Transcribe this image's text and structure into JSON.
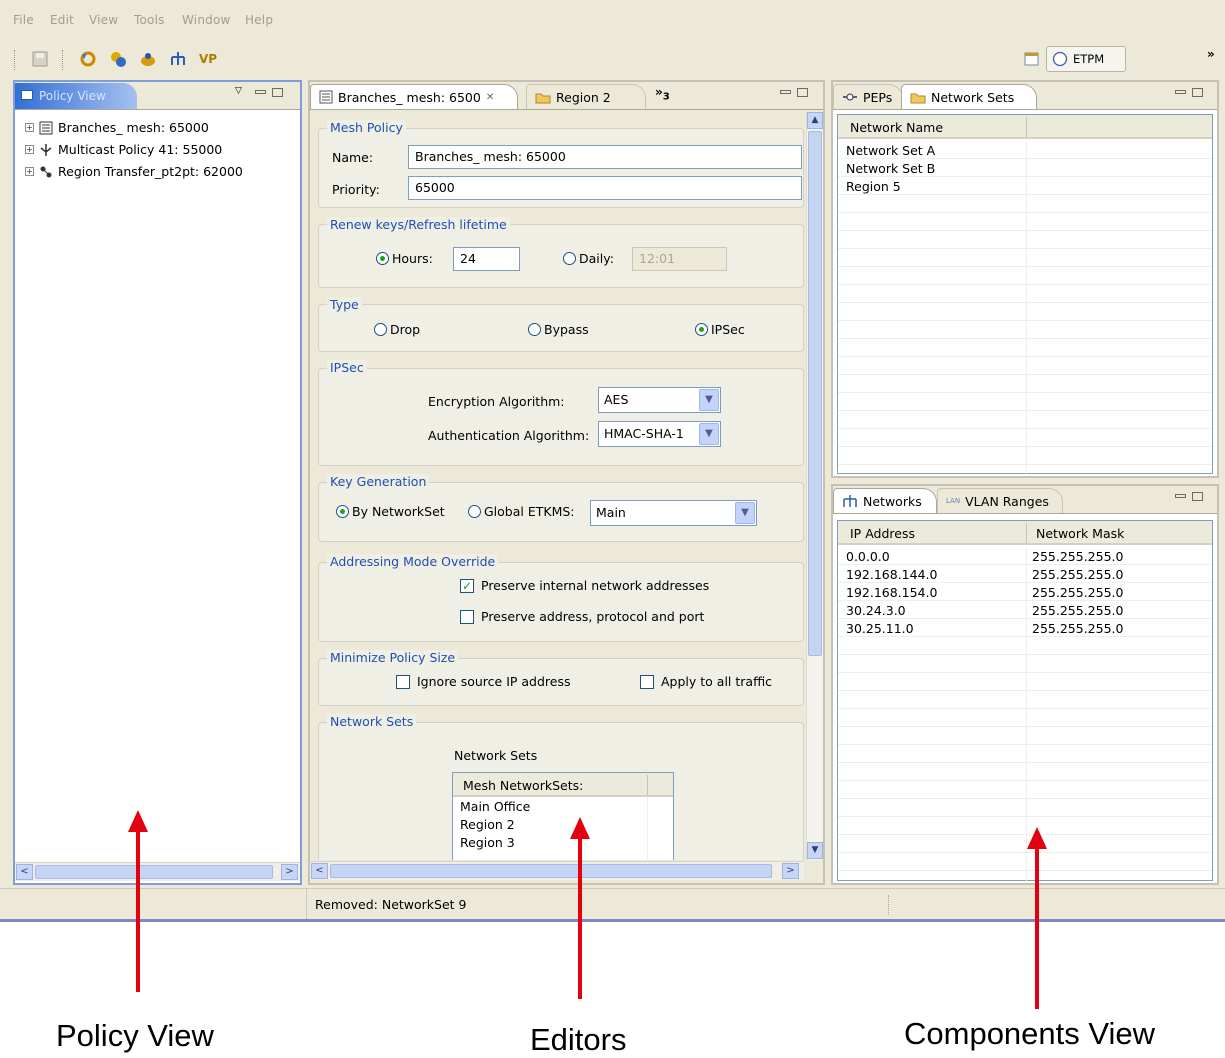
{
  "menu": [
    "File",
    "Edit",
    "View",
    "Tools",
    "Window",
    "Help"
  ],
  "toolbar": {
    "vp_label": "VP",
    "perspective_label": "ETPM",
    "chevron": "»"
  },
  "policy_view": {
    "tab_label": "Policy View",
    "items": [
      {
        "label": "Branches_ mesh: 65000",
        "icon": "mesh-policy-icon"
      },
      {
        "label": "Multicast Policy 41: 55000",
        "icon": "multicast-policy-icon"
      },
      {
        "label": "Region Transfer_pt2pt: 62000",
        "icon": "pt2pt-policy-icon"
      }
    ]
  },
  "editor": {
    "tabs": [
      {
        "label": "Branches_ mesh: 6500"
      },
      {
        "label": "Region 2"
      },
      {
        "label": "3"
      }
    ],
    "mesh_policy": {
      "title": "Mesh Policy",
      "name_label": "Name:",
      "name_value": "Branches_ mesh: 65000",
      "priority_label": "Priority:",
      "priority_value": "65000"
    },
    "renew": {
      "title": "Renew keys/Refresh lifetime",
      "hours_label": "Hours:",
      "hours_value": "24",
      "daily_label": "Daily:",
      "daily_value": "12:01"
    },
    "type": {
      "title": "Type",
      "options": [
        "Drop",
        "Bypass",
        "IPSec"
      ],
      "selected": "IPSec"
    },
    "ipsec": {
      "title": "IPSec",
      "enc_label": "Encryption Algorithm:",
      "enc_value": "AES",
      "auth_label": "Authentication Algorithm:",
      "auth_value": "HMAC-SHA-1"
    },
    "keygen": {
      "title": "Key Generation",
      "by_networkset_label": "By NetworkSet",
      "global_label": "Global ETKMS:",
      "global_value": "Main"
    },
    "addressing": {
      "title": "Addressing Mode Override",
      "preserve_internal": "Preserve internal network addresses",
      "preserve_internal_checked": true,
      "preserve_address": "Preserve address, protocol and port",
      "preserve_address_checked": false
    },
    "minimize": {
      "title": "Minimize Policy Size",
      "ignore_source": "Ignore source IP address",
      "apply_all": "Apply to all traffic"
    },
    "network_sets": {
      "title": "Network Sets",
      "subtitle": "Network Sets",
      "column": "Mesh NetworkSets:",
      "rows": [
        "Main Office",
        "Region 2",
        "Region 3"
      ]
    }
  },
  "components_top": {
    "tabs": [
      {
        "label": "PEPs"
      },
      {
        "label": "Network Sets"
      }
    ],
    "column": "Network Name",
    "rows": [
      "Network Set A",
      "Network Set B",
      "Region 5"
    ]
  },
  "components_bottom": {
    "tabs": [
      {
        "label": "Networks"
      },
      {
        "label": "VLAN Ranges"
      }
    ],
    "columns": [
      "IP Address",
      "Network Mask"
    ],
    "rows": [
      [
        "0.0.0.0",
        "255.255.255.0"
      ],
      [
        "192.168.144.0",
        "255.255.255.0"
      ],
      [
        "192.168.154.0",
        "255.255.255.0"
      ],
      [
        "30.24.3.0",
        "255.255.255.0"
      ],
      [
        "30.25.11.0",
        "255.255.255.0"
      ]
    ]
  },
  "status": {
    "message": "Removed: NetworkSet 9"
  },
  "captions": [
    "Policy View",
    "Editors",
    "Components View"
  ],
  "colors": {
    "accent": "#316ac5",
    "group_title": "#1f4fb0",
    "arrow": "#e3000f"
  }
}
